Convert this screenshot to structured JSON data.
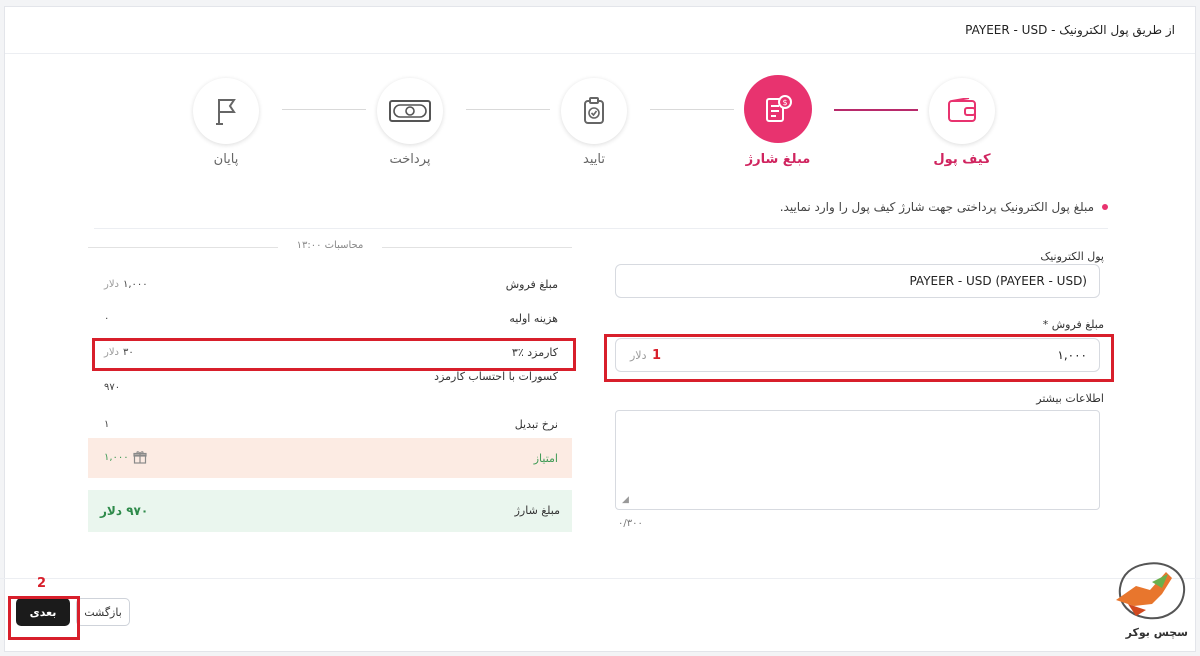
{
  "page": {
    "title": "از طریق پول الکترونیک - PAYEER - USD"
  },
  "stepper": {
    "steps": [
      {
        "label": "کیف پول",
        "icon": "wallet-icon",
        "state": "done"
      },
      {
        "label": "مبلغ شارژ",
        "icon": "invoice-dollar-icon",
        "state": "active"
      },
      {
        "label": "تایید",
        "icon": "clipboard-check-icon",
        "state": "pending"
      },
      {
        "label": "پرداخت",
        "icon": "banknote-icon",
        "state": "pending"
      },
      {
        "label": "پایان",
        "icon": "flag-icon",
        "state": "pending"
      }
    ],
    "accent": "#e8336f"
  },
  "instruction": "مبلغ پول الکترونیک پرداختی جهت شارژ کیف پول را وارد نمایید.",
  "form": {
    "ecurrency": {
      "label": "پول الکترونیک",
      "value": "PAYEER - USD (PAYEER - USD)"
    },
    "amount": {
      "label": "مبلغ فروش *",
      "value": "۱,۰۰۰",
      "unit": "دلار"
    },
    "info": {
      "label": "اطلاعات بیشتر",
      "counter": "۰/۳۰۰"
    }
  },
  "calc": {
    "header": "محاسبات ۱۳:۰۰",
    "rows": [
      {
        "label": "مبلغ فروش",
        "value": "۱,۰۰۰",
        "unit": "دلار"
      },
      {
        "label": "هزینه اولیه",
        "value": "۰",
        "unit": ""
      },
      {
        "label": "کارمزد ٪۳",
        "value": "۳۰",
        "unit": "دلار"
      },
      {
        "label": "کسورات با احتساب کارمزد",
        "value": "۹۷۰",
        "unit": ""
      },
      {
        "label": "نرخ تبدیل",
        "value": "۱",
        "unit": ""
      }
    ],
    "points": {
      "label": "امتیاز",
      "value": "۱,۰۰۰"
    },
    "total": {
      "label": "مبلغ شارژ",
      "value": "۹۷۰ دلار"
    }
  },
  "buttons": {
    "next": "بعدی",
    "back": "بازگشت"
  },
  "annotations": {
    "a1": "1",
    "a2": "2"
  },
  "watermark": {
    "text": "سچس بوکر"
  }
}
